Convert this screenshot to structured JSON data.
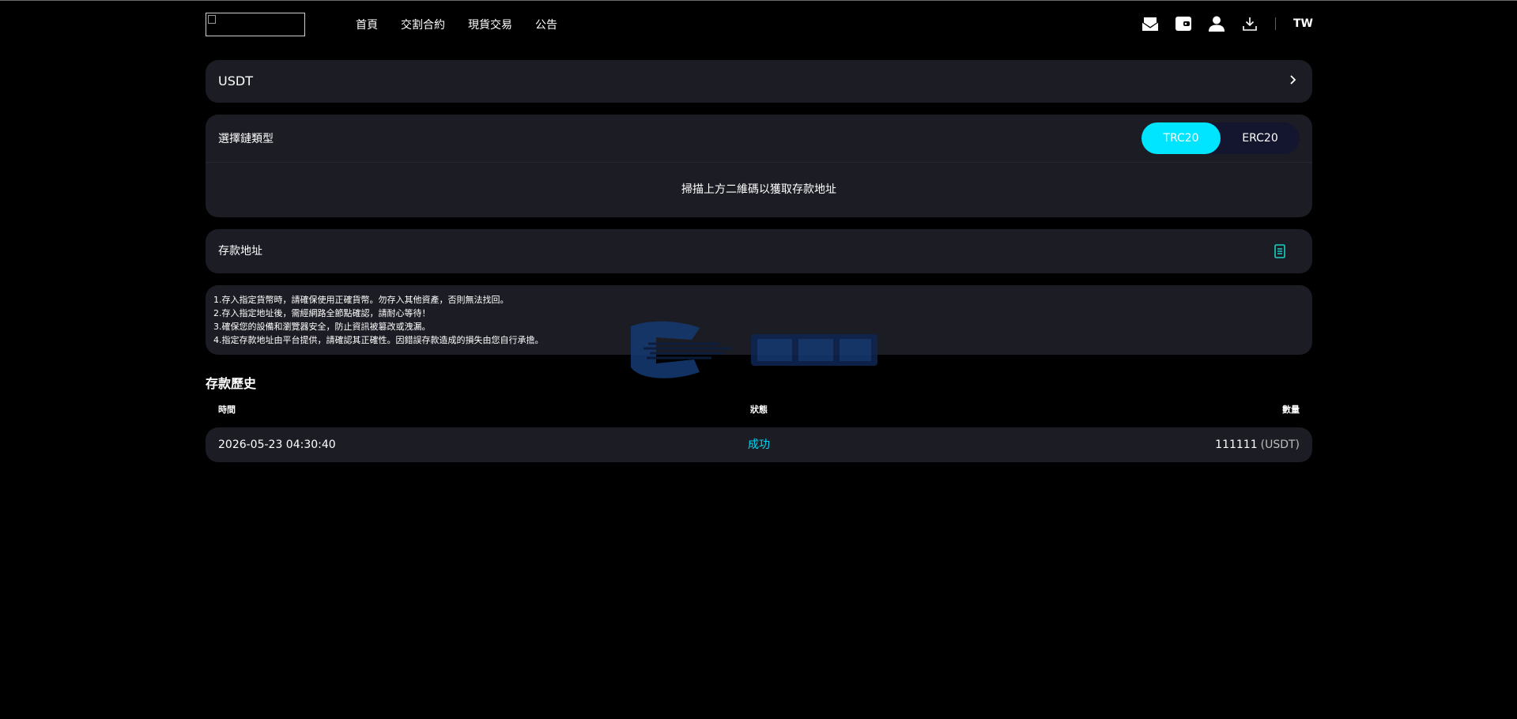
{
  "header": {
    "nav": [
      "首頁",
      "交割合約",
      "現貨交易",
      "公告"
    ],
    "icons": [
      "mail-icon",
      "wallet-icon",
      "user-icon",
      "download-icon"
    ],
    "lang": "TW"
  },
  "coin": {
    "selected": "USDT"
  },
  "chain": {
    "label": "選擇鏈類型",
    "options": [
      "TRC20",
      "ERC20"
    ],
    "active": "TRC20",
    "qr_hint": "掃描上方二維碼以獲取存款地址"
  },
  "address": {
    "label": "存款地址"
  },
  "notes": [
    "1.存入指定貨幣時，請確保使用正確貨幣。勿存入其他資產，否則無法找回。",
    "2.存入指定地址後，需經網路全節點確認，請耐心等待！",
    "3.確保您的設備和瀏覽器安全，防止資訊被篡改或洩漏。",
    "4.指定存款地址由平台提供，請確認其正確性。因錯誤存款造成的損失由您自行承擔。"
  ],
  "history": {
    "title": "存款歷史",
    "columns": [
      "時間",
      "狀態",
      "數量"
    ],
    "rows": [
      {
        "time": "2026-05-23 04:30:40",
        "status": "成功",
        "amount": "111111",
        "unit": "(USDT)"
      }
    ]
  },
  "colors": {
    "accent": "#00e5ff",
    "card": "#1c1d24",
    "background": "#000000",
    "separator": "#e0213f",
    "success": "#00d8f5"
  }
}
